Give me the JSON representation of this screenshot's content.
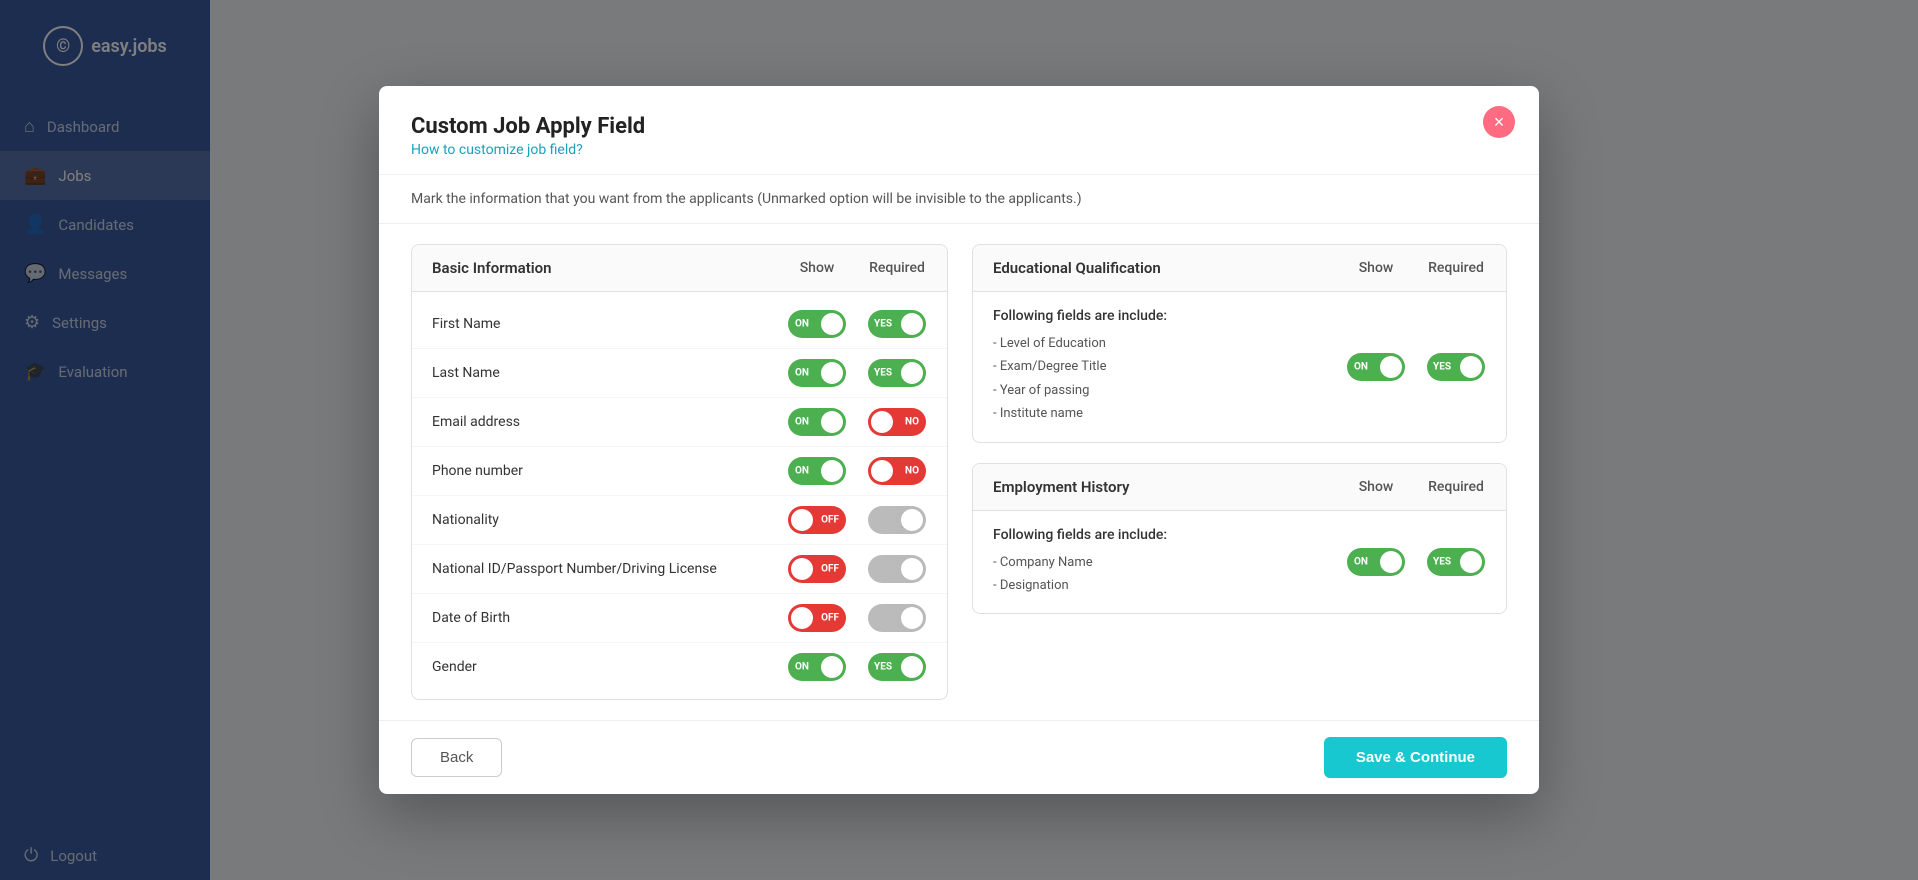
{
  "app": {
    "name": "easy.jobs",
    "logo_symbol": "©"
  },
  "sidebar": {
    "items": [
      {
        "id": "dashboard",
        "label": "Dashboard",
        "icon": "⌂",
        "active": false
      },
      {
        "id": "jobs",
        "label": "Jobs",
        "icon": "💼",
        "active": true
      },
      {
        "id": "candidates",
        "label": "Candidates",
        "icon": "👤",
        "active": false
      },
      {
        "id": "messages",
        "label": "Messages",
        "icon": "💬",
        "active": false
      },
      {
        "id": "settings",
        "label": "Settings",
        "icon": "⚙",
        "active": false
      },
      {
        "id": "evaluation",
        "label": "Evaluation",
        "icon": "🎓",
        "active": false
      },
      {
        "id": "logout",
        "label": "Logout",
        "icon": "⏻",
        "active": false
      }
    ]
  },
  "modal": {
    "title": "Custom Job Apply Field",
    "subtitle": "How to customize job field?",
    "description": "Mark the information that you want from the applicants (Unmarked option will be invisible to the applicants.)",
    "close_label": "×",
    "basic_info": {
      "section_title": "Basic Information",
      "show_label": "Show",
      "required_label": "Required",
      "fields": [
        {
          "name": "First Name",
          "show": "on",
          "required": "yes"
        },
        {
          "name": "Last Name",
          "show": "on",
          "required": "yes"
        },
        {
          "name": "Email address",
          "show": "on",
          "required": "no"
        },
        {
          "name": "Phone number",
          "show": "on",
          "required": "no"
        },
        {
          "name": "Nationality",
          "show": "off",
          "required": "disabled"
        },
        {
          "name": "National ID/Passport Number/Driving License",
          "show": "off",
          "required": "disabled"
        },
        {
          "name": "Date of Birth",
          "show": "off",
          "required": "disabled"
        },
        {
          "name": "Gender",
          "show": "on",
          "required": "yes"
        }
      ]
    },
    "educational_qualification": {
      "section_title": "Educational Qualification",
      "show_label": "Show",
      "required_label": "Required",
      "includes_label": "Following fields are include:",
      "show_state": "on",
      "required_state": "yes",
      "fields": [
        "- Level of Education",
        "- Exam/Degree Title",
        "- Year of passing",
        "- Institute name"
      ]
    },
    "employment_history": {
      "section_title": "Employment History",
      "show_label": "Show",
      "required_label": "Required",
      "includes_label": "Following fields are include:",
      "show_state": "on",
      "required_state": "yes",
      "fields": [
        "- Company Name",
        "- Designation"
      ]
    },
    "footer": {
      "back_label": "Back",
      "save_label": "Save & Continue"
    }
  }
}
